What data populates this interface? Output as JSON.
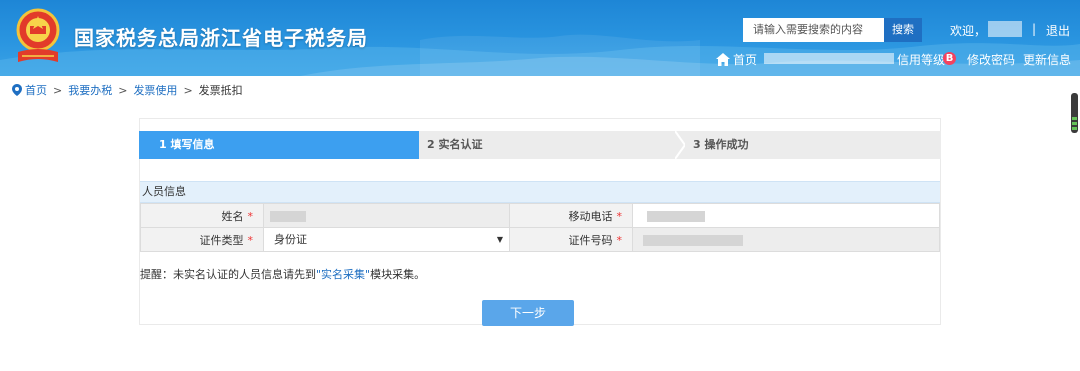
{
  "header": {
    "site_title": "国家税务总局浙江省电子税务局",
    "search_placeholder": "请输入需要搜索的内容",
    "search_button": "搜索",
    "welcome": "欢迎，",
    "separator": "|",
    "logout": "退出",
    "home": "首页",
    "credit_level": "信用等级",
    "credit_badge": "B",
    "change_password": "修改密码",
    "update_info": "更新信息",
    "colors": {
      "header_bg": "#2a95e0",
      "search_button_bg": "#1f6fc2",
      "badge_bg": "#f3425f"
    }
  },
  "breadcrumb": {
    "items": [
      "首页",
      "我要办税",
      "发票使用",
      "发票抵扣"
    ],
    "separator": ">"
  },
  "steps": [
    {
      "label": "1  填写信息",
      "state": "active"
    },
    {
      "label": "2  实名认证",
      "state": "pending"
    },
    {
      "label": "3  操作成功",
      "state": "pending"
    }
  ],
  "section": {
    "title": "人员信息"
  },
  "form": {
    "name_label": "姓名",
    "mobile_label": "移动电话",
    "id_type_label": "证件类型",
    "id_number_label": "证件号码",
    "required_mark": "*",
    "id_type_value": "身份证",
    "id_type_arrow": "▼"
  },
  "tip": {
    "prefix": "提醒：未实名认证的人员信息请先到",
    "link": "\"实名采集\"",
    "suffix": "模块采集。"
  },
  "actions": {
    "next_button": "下一步",
    "next_button_color": "#5aa6ea"
  },
  "accent_color": "#3c9ff0"
}
